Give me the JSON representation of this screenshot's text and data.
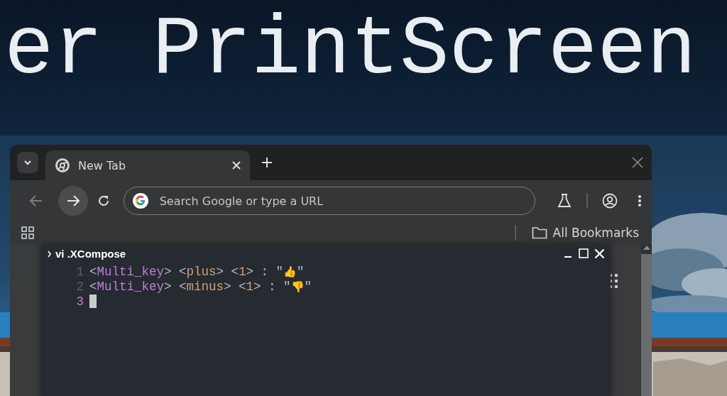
{
  "banner": {
    "title": "er PrintScreen"
  },
  "browser": {
    "tabs": [
      {
        "title": "New Tab",
        "selected": true
      }
    ],
    "omnibox": {
      "placeholder": "Search Google or type a URL"
    },
    "bookmarks": [
      {
        "label": "All Bookmarks"
      }
    ]
  },
  "terminal": {
    "title": "vi .XCompose",
    "lines": [
      {
        "number": "1",
        "current": false,
        "tokens": [
          {
            "kind": "punct",
            "text": "<"
          },
          {
            "kind": "name",
            "text": "Multi_key"
          },
          {
            "kind": "punct",
            "text": "> <"
          },
          {
            "kind": "arg",
            "text": "plus"
          },
          {
            "kind": "punct",
            "text": "> <"
          },
          {
            "kind": "arg",
            "text": "1"
          },
          {
            "kind": "punct",
            "text": "> : \""
          },
          {
            "kind": "emoji",
            "text": "👍"
          },
          {
            "kind": "punct",
            "text": "\""
          }
        ]
      },
      {
        "number": "2",
        "current": false,
        "tokens": [
          {
            "kind": "punct",
            "text": "<"
          },
          {
            "kind": "name",
            "text": "Multi_key"
          },
          {
            "kind": "punct",
            "text": "> <"
          },
          {
            "kind": "arg",
            "text": "minus"
          },
          {
            "kind": "punct",
            "text": "> <"
          },
          {
            "kind": "arg",
            "text": "1"
          },
          {
            "kind": "punct",
            "text": "> : \""
          },
          {
            "kind": "emoji",
            "text": "👎"
          },
          {
            "kind": "punct",
            "text": "\""
          }
        ]
      },
      {
        "number": "3",
        "current": true
      }
    ]
  }
}
